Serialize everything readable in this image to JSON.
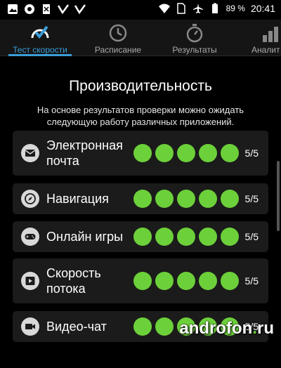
{
  "status_bar": {
    "battery": "89 %",
    "time": "20:41"
  },
  "tabs": [
    {
      "label": "Тест скорости",
      "active": true,
      "icon": "speedometer-check-icon"
    },
    {
      "label": "Расписание",
      "active": false,
      "icon": "refresh-clock-icon"
    },
    {
      "label": "Результаты",
      "active": false,
      "icon": "stopwatch-icon"
    },
    {
      "label": "Аналит",
      "active": false,
      "icon": "bar-chart-icon"
    }
  ],
  "main": {
    "title": "Производительность",
    "subtitle": "На основе результатов проверки можно ожидать следующую работу различных приложений."
  },
  "rows": [
    {
      "label": "Электронная почта",
      "icon": "mail-icon",
      "rating": 5,
      "max": 5,
      "score": "5/5"
    },
    {
      "label": "Навигация",
      "icon": "compass-icon",
      "rating": 5,
      "max": 5,
      "score": "5/5"
    },
    {
      "label": "Онлайн игры",
      "icon": "gamepad-icon",
      "rating": 5,
      "max": 5,
      "score": "5/5"
    },
    {
      "label": "Скорость потока",
      "icon": "play-icon",
      "rating": 5,
      "max": 5,
      "score": "5/5"
    },
    {
      "label": "Видео-чат",
      "icon": "video-camera-icon",
      "rating": 5,
      "max": 5,
      "score": "5/5"
    }
  ],
  "watermark": {
    "name": "androfon",
    "dot": ".",
    "tld": "ru"
  },
  "colors": {
    "accent": "#3a9ed8",
    "dot_green": "#6cd03a",
    "row_bg": "#1b1b1b"
  }
}
